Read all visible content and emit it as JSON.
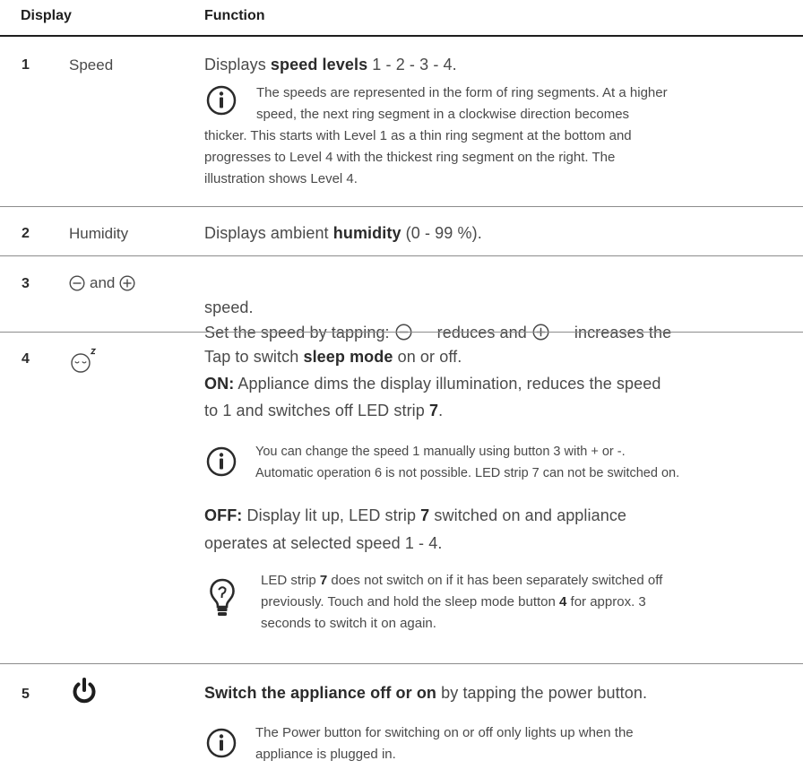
{
  "header": {
    "col_display": "Display",
    "col_function": "Function"
  },
  "rows": [
    {
      "num": "1",
      "name": "Speed",
      "text_pre": "Displays ",
      "text_bold": "speed levels",
      "text_post": " 1 - 2 - 3 - 4.",
      "note_icon": "info-icon",
      "note_line1": "The speeds are represented in the form of ring segments. At a higher",
      "note_line2": "speed, the next ring segment in a clockwise direction becomes",
      "note_line3": "thicker. This starts with Level 1 as a thin ring segment at the bottom and",
      "note_line4": "progresses to Level 4 with the thickest ring segment on the right. The",
      "note_line5": "illustration shows Level 4."
    },
    {
      "num": "2",
      "name": "Humidity",
      "text_pre": "Displays ambient ",
      "text_bold": "humidity",
      "text_post": " (0 - 99 %)."
    },
    {
      "num": "3",
      "name_and": "and",
      "name_icons": [
        "minus-circle-icon",
        "plus-circle-icon"
      ],
      "text_a": "Set the speed by tapping: ",
      "text_b": " reduces and ",
      "text_c": " increases the",
      "text_line2": "speed."
    },
    {
      "num": "4",
      "name_icon": "sleep-face-icon",
      "line1_pre": "Tap to switch ",
      "line1_bold": "sleep mode",
      "line1_post": " on or off.",
      "on_label": "ON:",
      "on_text": " Appliance dims the display illumination, reduces the speed",
      "on_line2_pre": "to 1 and switches off LED strip ",
      "on_line2_bold": "7",
      "on_line2_post": ".",
      "note_icon": "info-icon",
      "note_line1": "You can change the speed 1 manually using button 3 with + or -.",
      "note_line2": "Automatic operation 6 is not possible. LED strip 7 can not be switched on.",
      "off_label": "OFF:",
      "off_pre": " Display lit up, LED strip ",
      "off_bold": "7",
      "off_post": " switched on and appliance",
      "off_line2": "operates at selected speed 1 - 4.",
      "tip_icon": "lightbulb-icon",
      "tip_line1_pre": "LED strip ",
      "tip_line1_bold": "7",
      "tip_line1_post": " does not switch on if it has been separately switched off",
      "tip_line2_pre": "previously. Touch and hold the sleep mode button ",
      "tip_line2_bold": "4",
      "tip_line2_post": " for approx. 3",
      "tip_line3": "seconds to switch it on again."
    },
    {
      "num": "5",
      "name_icon": "power-icon",
      "text_bold": "Switch the appliance off or on",
      "text_post": " by tapping the power button.",
      "note_icon": "info-icon",
      "note_line1": "The Power button for switching on or off only lights up when the",
      "note_line2": "appliance is plugged in."
    }
  ]
}
